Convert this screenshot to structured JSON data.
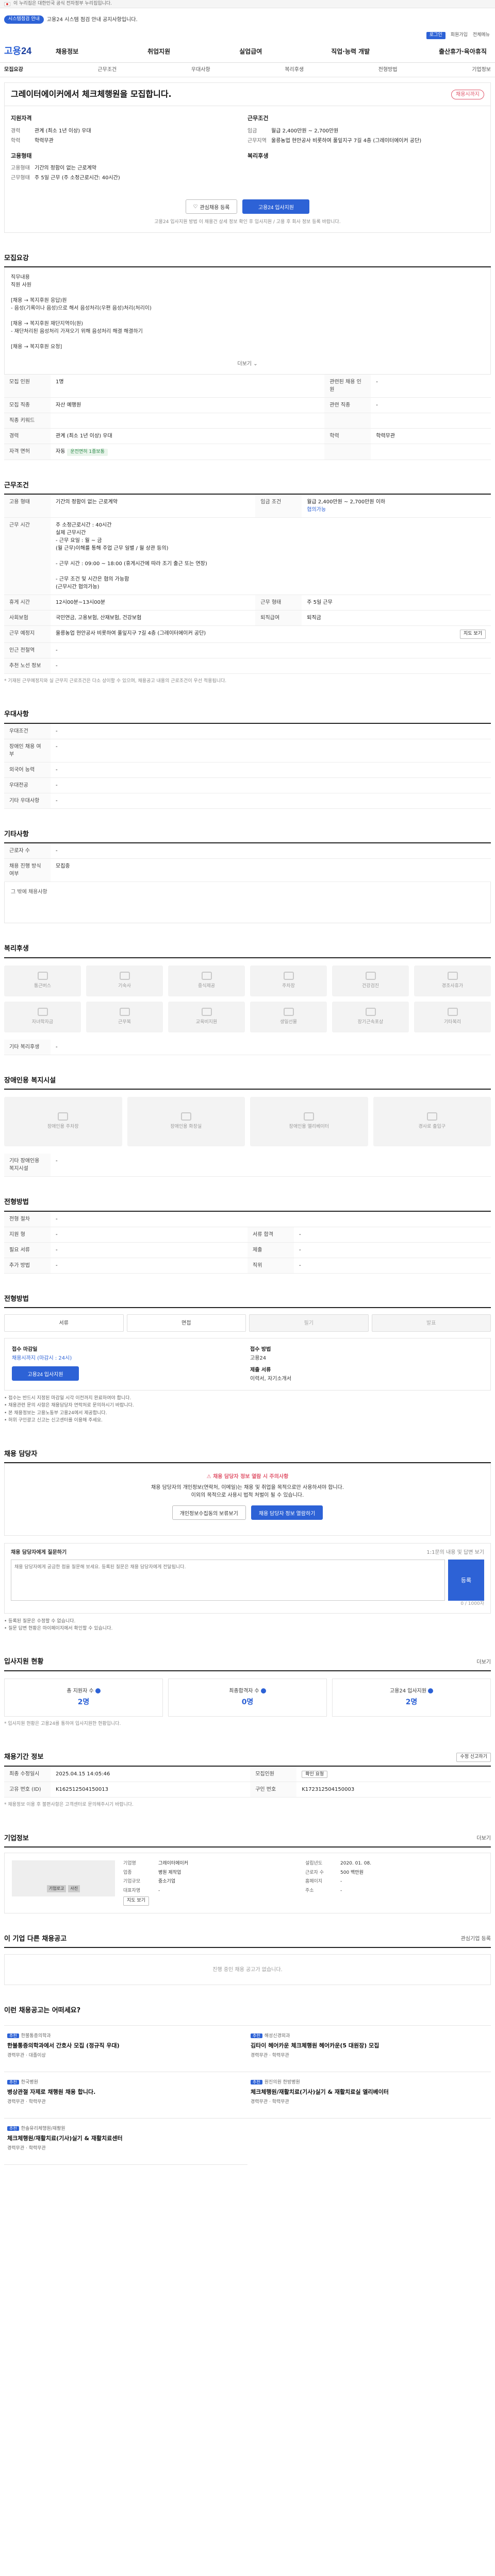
{
  "gov": {
    "text": "이 누리집은 대한민국 공식 전자정부 누리집입니다."
  },
  "notice": {
    "tag": "시스템점검 안내",
    "text": "고용24 시스템 점검 안내 공지사항입니다."
  },
  "util": {
    "login": "로그인",
    "join": "회원가입",
    "sitemap": "전체메뉴"
  },
  "logo": {
    "text1": "고용",
    "text2": "24"
  },
  "gnb": [
    "채용정보",
    "취업지원",
    "실업급여",
    "직업·능력 개발",
    "출산휴가·육아휴직"
  ],
  "subtabs": [
    "모집요강",
    "근무조건",
    "우대사항",
    "복리후생",
    "전형방법",
    "기업정보"
  ],
  "job": {
    "title": "그레이터에이커에서 체크체행원을 모집합니다.",
    "badge": "채용시까지",
    "left_h": "지원자격",
    "left": [
      {
        "k": "경력",
        "v": "관계 (최소 1년 이상) 우대"
      },
      {
        "k": "학력",
        "v": "학력무관"
      }
    ],
    "left_h2": "고용형태",
    "left2": [
      {
        "k": "고용형태",
        "v": "기간의 정함이 없는 근로계약"
      },
      {
        "k": "근무형태",
        "v": "주 5일 근무 (주 소정근로시간: 40시간)"
      }
    ],
    "right_h": "근무조건",
    "right": [
      {
        "k": "임금",
        "v": "월급 2,400만원 ~ 2,700만원"
      },
      {
        "k": "근무지역",
        "v": "울릉농업 현안공사 비롯하여 풀잎지구 7길 4층 (그레이터에이커 공단)"
      }
    ],
    "right_h2": "복리후생",
    "btn_save": "관심채용 등록",
    "btn_apply": "고용24 입사지원",
    "note": "고용24 입사지원 방법 이 채용건 상세 정보 확인 후 입사지원 / 고용 후 회사 정보 등록 바랍니다."
  },
  "recruit": {
    "title": "모집요강",
    "desc_lines": [
      "직무내용",
      "직원 사원",
      "",
      "[채용 → 복지후원 응답)원",
      "- 음성(기록이나 음성)으로 해서 음성처리(우편 음성)처리(처리이)",
      "",
      "[채용 → 복지후원 재단지역이(원)",
      "- 재단처리된 음성처리 가져오기 위해 음성처리 해결 해결하기",
      "",
      "[채용 → 복지후원 요청]"
    ],
    "more": "더보기",
    "rows": [
      {
        "k": "모집 인원",
        "v": "1명",
        "k2": "관련된 채용 인원",
        "v2": "-"
      },
      {
        "k": "모집 직종",
        "v": "자산 예행원",
        "k2": "관련 직종",
        "v2": "-"
      },
      {
        "k": "직종 키워드",
        "v": "",
        "k2": "",
        "v2": ""
      },
      {
        "k": "경력",
        "v": "관계 (최소 1년 이상) 우대",
        "k2": "학력",
        "v2": "학력무관"
      },
      {
        "k": "자격 면허",
        "v": "자동",
        "pill": "운전면허 1종보통",
        "k2": "",
        "v2": ""
      }
    ]
  },
  "work": {
    "title": "근무조건",
    "rows": [
      {
        "k": "고용 형태",
        "v": "기간의 정함이 없는 근로계약",
        "k2": "임금 조건",
        "v2": "월급 2,400만원 ~ 2,700만원 이하",
        "sub": "협의가능"
      },
      {
        "k": "근무 시간",
        "v": "주 소정근로시간 : 40시간",
        "lines": [
          "실제 근무시간",
          "- 근무 요일 : 월 ~ 금",
          "           (월 근무)이해를 통해 주업 근무 일별 / 월 상관 등의)",
          "",
          "- 근무 시간 : 09:00 ~ 18:00 (휴게시간에 따라 조기 출근 또는 연장)",
          "",
          "- 근무 조건 및 시간은 협의 가능함",
          "  (근무시간 협의가능)"
        ]
      },
      {
        "k": "휴게 시간",
        "v": "12시00분~13시00분",
        "k2": "근무 형태",
        "v2": "주 5일 근무"
      },
      {
        "k": "사회보험",
        "v": "국민연금, 고용보험, 산재보험, 건강보험",
        "k2": "퇴직급여",
        "v2": "퇴직금"
      },
      {
        "k": "근무 예정지",
        "v": "울릉농업 현안공사 비롯하여 풀잎지구 7길 4층 (그레이터에이커 공단)",
        "btn": "지도 보기"
      },
      {
        "k": "인근 전철역",
        "v": "-"
      },
      {
        "k": "추천 노선 정보",
        "v": "-"
      }
    ],
    "note": "* 기재된 근무예정지와 실 근무지 근로조건은 다소 상이할 수 있으며, 채용공고 내용의 근로조건이 우선 적용됩니다."
  },
  "pref": {
    "title": "우대사항",
    "rows": [
      {
        "k": "우대조건",
        "v": "-"
      },
      {
        "k": "장애인 채용 여부",
        "v": "-"
      },
      {
        "k": "외국어 능력",
        "v": "-"
      },
      {
        "k": "우대전공",
        "v": "-"
      },
      {
        "k": "기타 우대사항",
        "v": "-"
      }
    ]
  },
  "etc": {
    "title": "기타사항",
    "rows": [
      {
        "k": "근로자 수",
        "v": "-"
      },
      {
        "k": "채용 진행 방식 여부",
        "v": "모집중"
      }
    ],
    "box": "그 밖에 채용사항"
  },
  "welfare": {
    "title": "복리후생",
    "items": [
      "통근버스",
      "기숙사",
      "중식제공",
      "주차장",
      "건강검진",
      "경조사휴가",
      "자녀학자금",
      "근무복",
      "교육비지원",
      "생일선물",
      "장기근속포상",
      "기타복리"
    ],
    "other_k": "기타 복리후생",
    "other_v": "-"
  },
  "disability": {
    "title": "장애인용 복지시설",
    "items": [
      "장애인용 주차장",
      "장애인용 화장실",
      "장애인용 엘리베이터",
      "경사로 출입구"
    ],
    "other_k": "기타 장애인용 복지시설",
    "other_v": "-"
  },
  "process": {
    "title": "전형방법",
    "rows": [
      {
        "k": "전형 절차",
        "v": "-"
      },
      {
        "k": "지원 형",
        "v": "-",
        "k2": "서류 합격",
        "v2": "-"
      },
      {
        "k": "필요 서류",
        "v": "-",
        "k2": "제출",
        "v2": "-"
      },
      {
        "k": "추가 방법",
        "v": "-",
        "k2": "직위",
        "v2": "-"
      }
    ]
  },
  "apply": {
    "title": "전형방법",
    "steps": [
      "서류",
      "면접",
      "필기",
      "발표"
    ],
    "deadline_h": "접수 마감일",
    "deadline": "채용시까지 (마감시 : 24시)",
    "method_h": "접수 방법",
    "method": "고용24",
    "btn": "고용24 입사지원",
    "doc_h": "제출 서류",
    "doc": "이력서, 자기소개서",
    "bullets": [
      "• 접수는 반드시 지정된 마감일 시각 이전까지 완료하여야 합니다.",
      "• 채용관련 문의 사항은 채용담당자 연락처로 문의하시기 바랍니다.",
      "• 본 채용정보는 고용노동부 고용24에서 제공합니다.",
      "• 허위 구인광고 신고는 신고센터를 이용해 주세요."
    ]
  },
  "contact": {
    "title": "채용 담당자",
    "warn": "채용 담당자 정보 열람 시 주의사항",
    "text1": "채용 담당자의 개인정보(연락처, 이메일)는 채용 및 취업을 목적으로만 사용하셔야 합니다.",
    "text2": "이외의 목적으로 사용시 법적 처벌이 될 수 있습니다.",
    "btn1": "개인정보수집동의 보류보기",
    "btn2": "채용 담당자 정보 열람하기",
    "inq_title": "채용 담당자에게 질문하기",
    "inq_side": "1:1문의 내용 및 답변 보기",
    "placeholder": "채용 담당자에게 궁금한 점을 질문해 보세요. 등록된 질문은 채용 담당자에게 전달됩니다.",
    "reg": "등록",
    "counter": "0 / 1000자",
    "notes": [
      "• 등록된 질문은 수정할 수 없습니다.",
      "• 질문 답변 현황은 마이페이지에서 확인할 수 있습니다."
    ]
  },
  "status": {
    "title": "입사지원 현황",
    "side": "더보기",
    "cards": [
      {
        "k": "총 지원자 수",
        "v": "2명"
      },
      {
        "k": "최종합격자 수",
        "v": "0명"
      },
      {
        "k": "고용24 입사지원",
        "v": "2명"
      }
    ],
    "note": "* 입사지원 현황은 고용24를 통하여 입사지원한 현황입니다."
  },
  "meta": {
    "title": "채용기간 정보",
    "side": "수정 신고하기",
    "rows": [
      {
        "k": "최종 수정일시",
        "v": "2025.04.15 14:05:46",
        "k2": "모집인원",
        "v2": "확인 요청",
        "btn": "확인 요청"
      },
      {
        "k": "고유 번호 (ID)",
        "v": "K162512504150013",
        "k2": "구인 번호",
        "v2": "K172312504150003"
      }
    ],
    "note": "* 채용정보 이용 후 불편사항은 고객센터로 문의해주시기 바랍니다."
  },
  "company": {
    "title": "기업정보",
    "side": "더보기",
    "rows": [
      {
        "k": "기업명",
        "v": "그레이터에이커",
        "k2": "설립년도",
        "v2": "2020. 01. 08."
      },
      {
        "k": "업종",
        "v": "병원 제작업",
        "k2": "근로자 수",
        "v2": "500 백만원"
      },
      {
        "k": "기업규모",
        "v": "중소기업",
        "k2": "홈페이지",
        "v2": "-"
      },
      {
        "k": "대표자명",
        "v": "-",
        "k2": "주소",
        "v2": "-"
      }
    ],
    "logo_tags": [
      "기업로고",
      "사진"
    ],
    "map_btn": "지도 보기"
  },
  "similar": {
    "title": "이 기업 다른 채용공고",
    "side": "관심기업 등록",
    "empty": "진행 중인 채용 공고가 없습니다."
  },
  "recommend": {
    "title": "이런 채용공고는 어떠세요?",
    "cards": [
      {
        "label": "추천",
        "co": "한불통증의학과",
        "title": "한불통증의학과에서 간호사 모집 (정규직 우대)",
        "meta": "경력무관 · 대졸이상"
      },
      {
        "label": "추천",
        "co": "해성신경외과",
        "title": "김타이 헤어카운 체크체행원 헤어카운(5 대원장) 모집",
        "meta": "경력무관 · 학력무관"
      },
      {
        "label": "추천",
        "co": "한국병원",
        "title": "병상관절 자제로 채행원 채용 합니다.",
        "meta": "경력무관 · 학력무관"
      },
      {
        "label": "추천",
        "co": "원진의원 한방병원",
        "title": "체크체행원/재활치료(기사)실기 & 재활치료실 엘리베이터",
        "meta": "경력무관 · 학력무관"
      },
      {
        "label": "추천",
        "co": "한솔유리체행원/재활원",
        "title": "체크체행원/재활치료(기사)실기 & 재활치료센터",
        "meta": "경력무관 · 학력무관"
      }
    ]
  }
}
